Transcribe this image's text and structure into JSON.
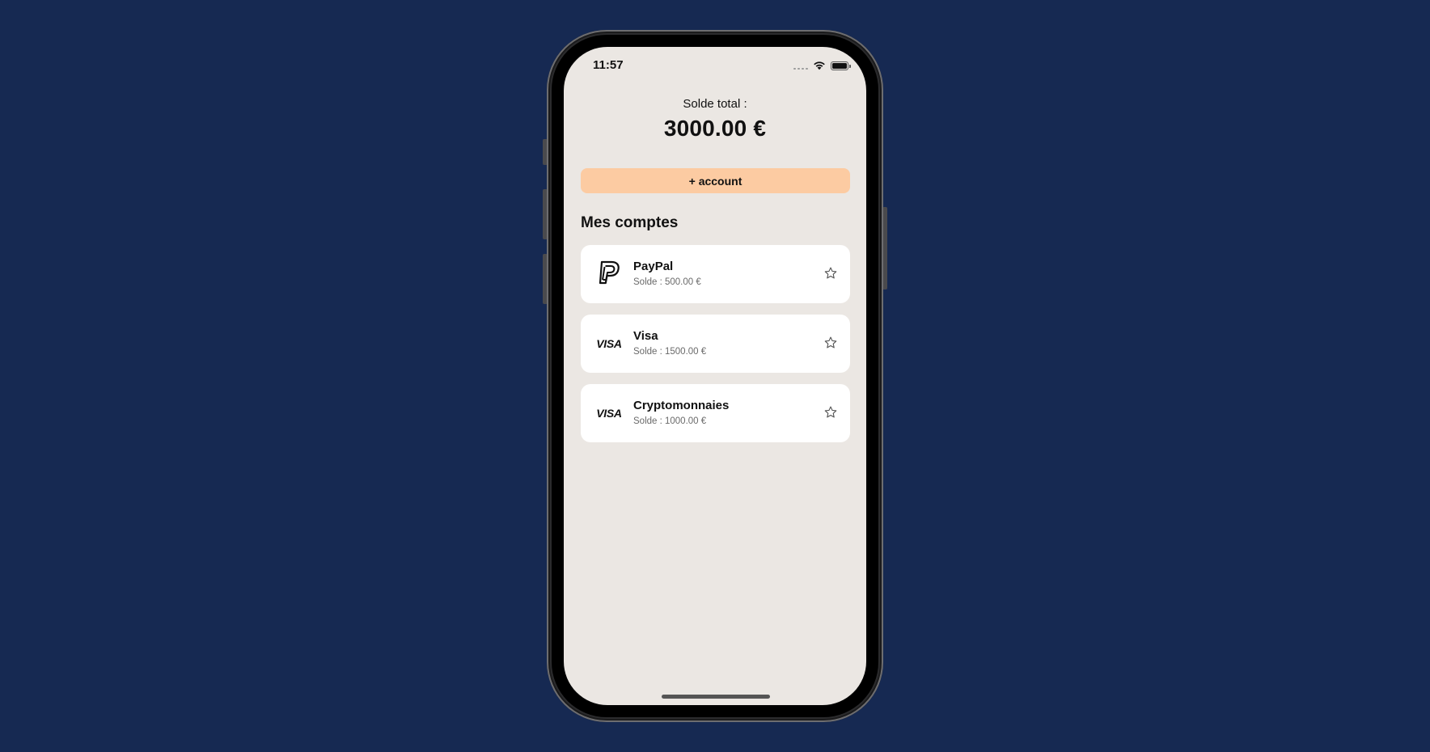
{
  "status_bar": {
    "time": "11:57",
    "icons": [
      "signal-icon",
      "wifi-icon",
      "battery-icon"
    ]
  },
  "balance": {
    "label": "Solde total :",
    "value": "3000.00 €"
  },
  "add_account": {
    "label": "+ account"
  },
  "accounts_section": {
    "title": "Mes comptes",
    "accounts": [
      {
        "name": "PayPal",
        "balance": "Solde : 500.00 €",
        "logo": "paypal-icon",
        "favorite": false
      },
      {
        "name": "Visa",
        "balance": "Solde : 1500.00 €",
        "logo": "visa-icon",
        "logo_text": "VISA",
        "favorite": false
      },
      {
        "name": "Cryptomonnaies",
        "balance": "Solde : 1000.00 €",
        "logo": "visa-icon",
        "logo_text": "VISA",
        "favorite": false
      }
    ]
  },
  "colors": {
    "background": "#162952",
    "screen": "#ebe7e3",
    "accent_button": "#fccba2",
    "card": "#ffffff"
  }
}
